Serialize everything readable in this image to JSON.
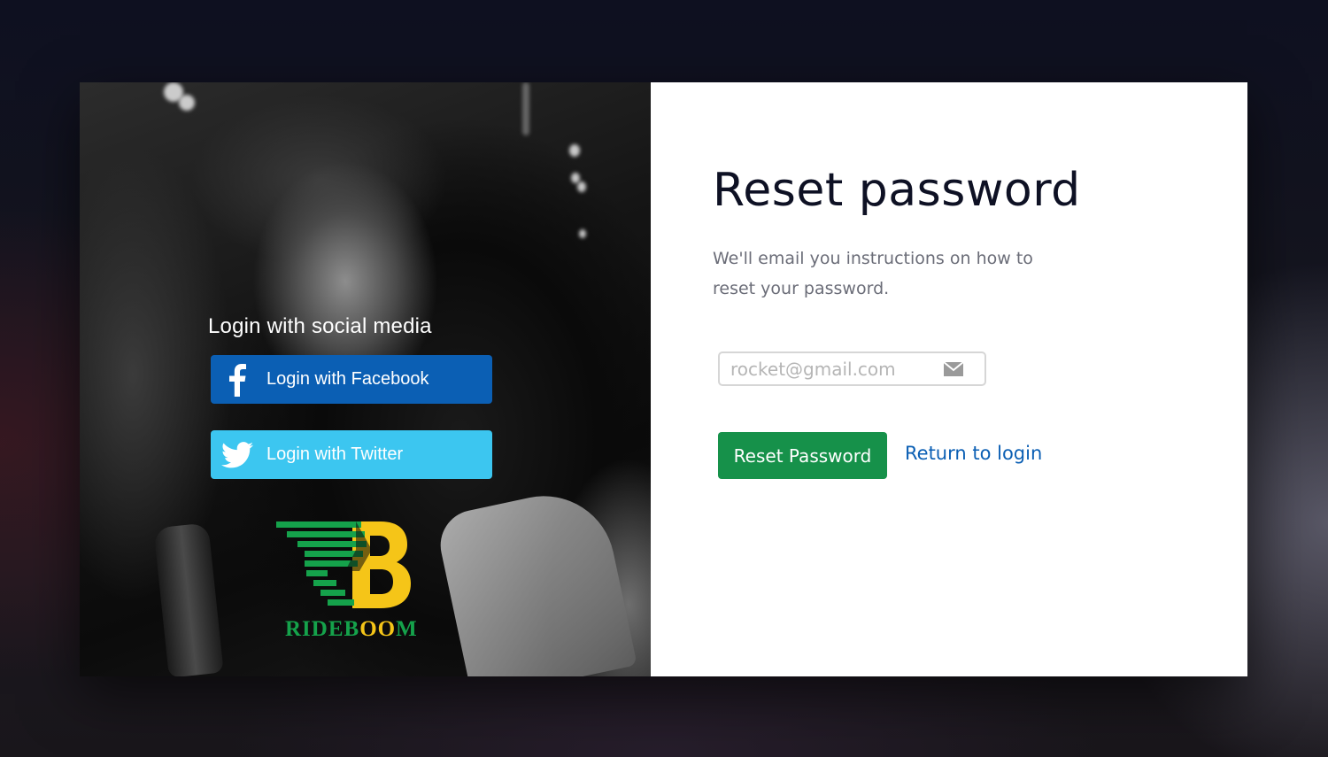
{
  "social": {
    "title": "Login with social media",
    "facebook_label": "Login with Facebook",
    "twitter_label": "Login with Twitter",
    "facebook_icon": "facebook-icon",
    "twitter_icon": "twitter-icon"
  },
  "brand": {
    "name": "RIDEBOOM",
    "logo_icon": "rideboom-logo",
    "colors": {
      "green": "#15a24b",
      "yellow": "#f5c518"
    }
  },
  "form": {
    "title": "Reset password",
    "description": "We'll email you instructions on how to reset your password.",
    "email_placeholder": "rocket@gmail.com",
    "email_icon": "envelope-icon",
    "reset_button": "Reset Password",
    "return_link": "Return to login"
  },
  "colors": {
    "facebook": "#0b5fb4",
    "twitter": "#3cc6f0",
    "primary_button": "#16914a",
    "link": "#0b5fb4",
    "title": "#0e1124",
    "muted_text": "#6b6d78"
  }
}
